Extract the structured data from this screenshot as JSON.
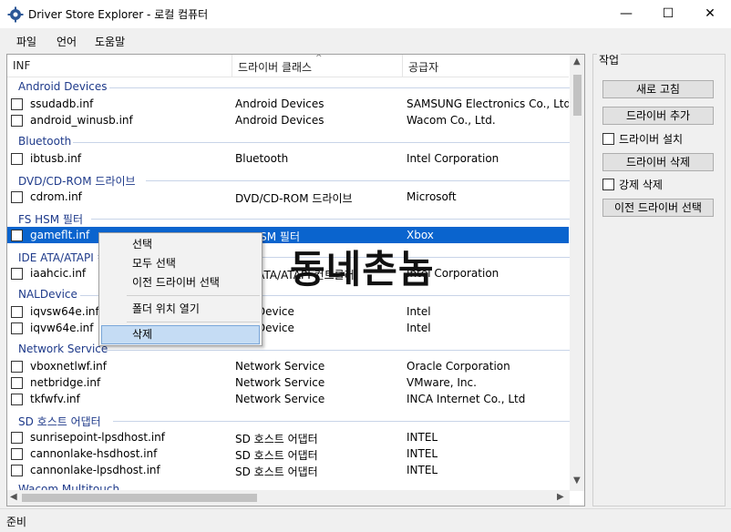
{
  "window": {
    "title": "Driver Store Explorer - 로컬 컴퓨터",
    "minimize": "—",
    "maximize": "☐",
    "close": "✕"
  },
  "menu": [
    "파일",
    "언어",
    "도움말"
  ],
  "columns": [
    "INF",
    "드라이버 클래스",
    "공급자"
  ],
  "groups": {
    "android": "Android Devices",
    "bluetooth": "Bluetooth",
    "dvd": "DVD/CD-ROM 드라이브",
    "fshsm": "FS HSM 필터",
    "ide": "IDE ATA/ATAPI 컨트롤러",
    "nal": "NALDevice",
    "network": "Network Service",
    "sd": "SD 호스트 어댑터",
    "wacom": "Wacom Multitouch"
  },
  "rows": [
    [
      "ssudadb.inf",
      "Android Devices",
      "SAMSUNG Electronics Co., Ltd"
    ],
    [
      "android_winusb.inf",
      "Android Devices",
      "Wacom Co., Ltd."
    ],
    [
      "ibtusb.inf",
      "Bluetooth",
      "Intel Corporation"
    ],
    [
      "cdrom.inf",
      "DVD/CD-ROM 드라이브",
      "Microsoft"
    ],
    [
      "gameflt.inf",
      "FS HSM 필터",
      "Xbox"
    ],
    [
      "iaahcic.inf",
      "IDE ATA/ATAPI 컨트롤러",
      "Intel Corporation"
    ],
    [
      "iqvsw64e.inf",
      "NALDevice",
      "Intel"
    ],
    [
      "iqvw64e.inf",
      "NALDevice",
      "Intel"
    ],
    [
      "vboxnetlwf.inf",
      "Network Service",
      "Oracle Corporation"
    ],
    [
      "netbridge.inf",
      "Network Service",
      "VMware, Inc."
    ],
    [
      "tkfwfv.inf",
      "Network Service",
      "INCA Internet Co., Ltd"
    ],
    [
      "sunrisepoint-lpsdhost.inf",
      "SD 호스트 어댑터",
      "INTEL"
    ],
    [
      "cannonlake-hsdhost.inf",
      "SD 호스트 어댑터",
      "INTEL"
    ],
    [
      "cannonlake-lpsdhost.inf",
      "SD 호스트 어댑터",
      "INTEL"
    ]
  ],
  "actions": {
    "legend": "작업",
    "refresh": "새로 고침",
    "add_driver": "드라이버 추가",
    "install_driver": "드라이버 설치",
    "delete_driver": "드라이버 삭제",
    "force_delete": "강제 삭제",
    "select_old": "이전 드라이버 선택"
  },
  "context_menu": {
    "select": "선택",
    "select_all": "모두 선택",
    "select_old": "이전 드라이버 선택",
    "open_folder": "폴더 위치 열기",
    "delete": "삭제"
  },
  "status": "준비",
  "watermark": "동네촌놈",
  "colors": {
    "selection": "#0a64ce",
    "group_text": "#1e3a8a",
    "menu_hot": "#c5dcf4"
  }
}
